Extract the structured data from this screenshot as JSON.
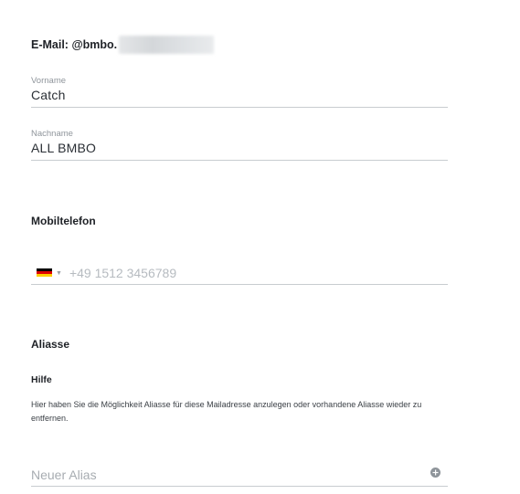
{
  "account": {
    "email_label": "E-Mail: @bmbo."
  },
  "vorname": {
    "label": "Vorname",
    "value": "Catch"
  },
  "nachname": {
    "label": "Nachname",
    "value": "ALL BMBO"
  },
  "mobil": {
    "title": "Mobiltelefon",
    "country_icon": "germany-flag-icon",
    "placeholder": "+49 1512 3456789"
  },
  "aliasse": {
    "title": "Aliasse",
    "help_title": "Hilfe",
    "help_text": "Hier haben Sie die Möglichkeit Aliasse für diese Mailadresse anzulegen oder vorhandene Aliasse wieder zu entfernen.",
    "input_placeholder": "Neuer Alias",
    "add_icon": "plus-circle-icon"
  },
  "colors": {
    "underline": "#c8ccd0",
    "label_gray": "#8f959b",
    "placeholder_gray": "#b6bbc0",
    "text_dark": "#1e2126"
  }
}
